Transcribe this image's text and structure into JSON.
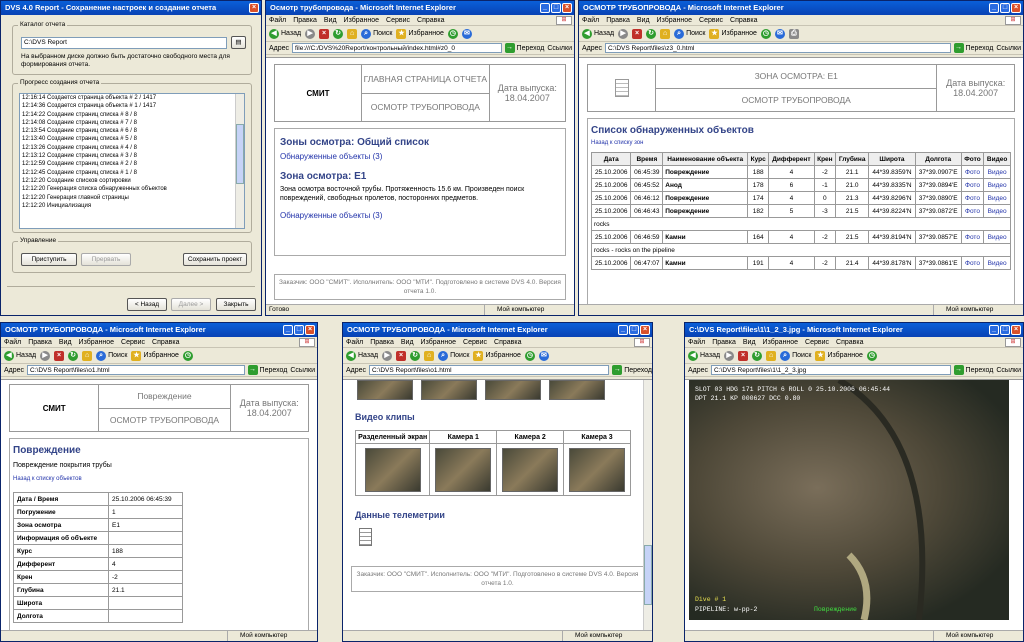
{
  "w1": {
    "title": "DVS 4.0 Report - Сохранение настроек и создание отчета",
    "catalog_label": "Каталог отчета",
    "path": "C:\\DVS Report",
    "note": "На выбранном диске должно быть достаточно свободного места для формирования отчета.",
    "progress_label": "Прогресс создания отчета",
    "log": [
      "12:16:14 Создается страница объекта # 2 / 1417",
      "12:14:36 Создается страница объекта # 1 / 1417",
      "12:14:22 Создание страниц списка # 8 / 8",
      "12:14:08 Создание страниц списка # 7 / 8",
      "12:13:54 Создание страниц списка # 6 / 8",
      "12:13:40 Создание страниц списка # 5 / 8",
      "12:13:26 Создание страниц списка # 4 / 8",
      "12:13:12 Создание страниц списка # 3 / 8",
      "12:12:59 Создание страниц списка # 2 / 8",
      "12:12:45 Создание страниц списка # 1 / 8",
      "12:12:20 Создание списков сортировки",
      "12:12:20 Генерация списка обнаруженных объектов",
      "12:12:20 Генерация главной страницы",
      "12:12:20 Инициализация"
    ],
    "control_label": "Управление",
    "start": "Приступить",
    "stop": "Прервать",
    "save": "Сохранить проект",
    "back": "< Назад",
    "next": "Далее >",
    "close": "Закрыть"
  },
  "ie": {
    "menu": [
      "Файл",
      "Правка",
      "Вид",
      "Избранное",
      "Сервис",
      "Справка"
    ],
    "back": "Назад",
    "search": "Поиск",
    "fav": "Избранное",
    "addr": "Адрес",
    "go": "Переход",
    "links": "Ссылки",
    "done": "Готово",
    "mycomp": "Мой компьютер"
  },
  "w2": {
    "title": "Осмотр трубопровода - Microsoft Internet Explorer",
    "url": "file:///C:/DVS%20Report/контрольный/index.html#z0_0",
    "hdr_left": "СМИТ",
    "hdr_top": "ГЛАВНАЯ СТРАНИЦА ОТЧЕТА",
    "hdr_bot": "ОСМОТР ТРУБОПРОВОДА",
    "hdr_date": "Дата выпуска: 18.04.2007",
    "h_zones": "Зоны осмотра: Общий список",
    "link1": "Обнаруженные объекты (3)",
    "h_zone": "Зона осмотра: E1",
    "desc": "Зона осмотра восточной трубы. Протяженность 15.6 км. Произведен поиск повреждений, свободных пролетов, посторонних предметов.",
    "link2": "Обнаруженные объекты (3)",
    "footer": "Заказчик: ООО \"СМИТ\". Исполнитель: ООО \"МТИ\". Подготовлено в системе DVS 4.0. Версия отчета 1.0."
  },
  "w3": {
    "title": "ОСМОТР ТРУБОПРОВОДА - Microsoft Internet Explorer",
    "url": "C:\\DVS Report\\files\\z3_0.html",
    "hdr_top": "ЗОНА ОСМОТРА: E1",
    "hdr_bot": "ОСМОТР ТРУБОПРОВОДА",
    "hdr_date": "Дата выпуска: 18.04.2007",
    "h": "Список обнаруженных объектов",
    "back_link": "Назад к списку зон",
    "cols": [
      "Дата",
      "Время",
      "Наименование объекта",
      "Курс",
      "Дифферент",
      "Крен",
      "Глубина",
      "Широта",
      "Долгота",
      "Фото",
      "Видео"
    ],
    "rows": [
      {
        "c": [
          "25.10.2006",
          "06:45:39",
          "Повреждение",
          "188",
          "4",
          "-2",
          "21.1",
          "44*39.8359'N",
          "37*39.0907'E",
          "Фото",
          "Видео"
        ],
        "note": ""
      },
      {
        "c": [
          "25.10.2006",
          "06:45:52",
          "Анод",
          "178",
          "6",
          "-1",
          "21.0",
          "44*39.8335'N",
          "37*39.0894'E",
          "Фото",
          "Видео"
        ],
        "note": ""
      },
      {
        "c": [
          "25.10.2006",
          "06:46:12",
          "Повреждение",
          "174",
          "4",
          "0",
          "21.3",
          "44*39.8296'N",
          "37*39.0890'E",
          "Фото",
          "Видео"
        ],
        "note": ""
      },
      {
        "c": [
          "25.10.2006",
          "06:46:43",
          "Повреждение",
          "182",
          "5",
          "-3",
          "21.5",
          "44*39.8224'N",
          "37*39.0872'E",
          "Фото",
          "Видео"
        ],
        "note": "rocks"
      },
      {
        "c": [
          "25.10.2006",
          "06:46:59",
          "Камни",
          "164",
          "4",
          "-2",
          "21.5",
          "44*39.8194'N",
          "37*39.0857'E",
          "Фото",
          "Видео"
        ],
        "note": "rocks - rocks on the pipeline"
      },
      {
        "c": [
          "25.10.2006",
          "06:47:07",
          "Камни",
          "191",
          "4",
          "-2",
          "21.4",
          "44*39.8178'N",
          "37*39.0861'E",
          "Фото",
          "Видео"
        ],
        "note": ""
      }
    ]
  },
  "w4": {
    "title": "ОСМОТР ТРУБОПРОВОДА - Microsoft Internet Explorer",
    "url": "C:\\DVS Report\\files\\o1.html",
    "hdr_left": "СМИТ",
    "hdr_top": "Повреждение",
    "hdr_bot": "ОСМОТР ТРУБОПРОВОДА",
    "hdr_date": "Дата выпуска: 18.04.2007",
    "h": "Повреждение",
    "sub": "Повреждение покрытия трубы",
    "back_link": "Назад к списку объектов",
    "props": [
      [
        "Дата / Время",
        "25.10.2006 06:45:39"
      ],
      [
        "Погружение",
        "1"
      ],
      [
        "Зона осмотра",
        "E1"
      ],
      [
        "Информация об объекте",
        ""
      ],
      [
        "Курс",
        "188"
      ],
      [
        "Дифферент",
        "4"
      ],
      [
        "Крен",
        "-2"
      ],
      [
        "Глубина",
        "21.1"
      ],
      [
        "Широта",
        ""
      ],
      [
        "Долгота",
        ""
      ]
    ]
  },
  "w5": {
    "title": "ОСМОТР ТРУБОПРОВОДА - Microsoft Internet Explorer",
    "url": "C:\\DVS Report\\files\\o1.html",
    "h_video": "Видео клипы",
    "cams": [
      "Разделенный экран",
      "Камера 1",
      "Камера 2",
      "Камера 3"
    ],
    "h_tel": "Данные телеметрии",
    "footer": "Заказчик: ООО \"СМИТ\". Исполнитель: ООО \"МТИ\". Подготовлено в системе DVS 4.0. Версия отчета 1.0."
  },
  "w6": {
    "title": "C:\\DVS Report\\files\\1\\1_2_3.jpg - Microsoft Internet Explorer",
    "url": "C:\\DVS Report\\files\\1\\1_2_3.jpg",
    "osd1": "SLOT 03   HDG 171   PITCH 6     ROLL 0     25.10.2006     06:45:44",
    "osd2": "DPT 21.1   KP 000627  DCC 0.80",
    "dive": "Dive # 1",
    "pipeline": "PIPELINE: w-pp-2",
    "damage": "Повреждение"
  }
}
